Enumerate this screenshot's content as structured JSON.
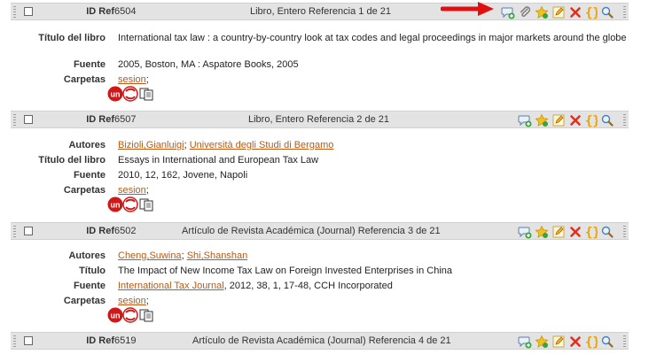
{
  "references": [
    {
      "id_label": "ID Ref",
      "id": "6504",
      "title": "Libro, Entero Referencia 1 de 21",
      "fields": [
        {
          "label": "Título del libro",
          "value": "International tax law : a country-by-country look at tax codes and legal proceedings in major markets around the globe"
        },
        {
          "label": "Fuente",
          "value": "2005, Boston, MA : Aspatore Books, 2005"
        },
        {
          "label": "Carpetas",
          "link": "sesion",
          "suffix": ";"
        }
      ]
    },
    {
      "id_label": "ID Ref",
      "id": "6507",
      "title": "Libro, Entero Referencia 2 de 21",
      "fields": [
        {
          "label": "Autores",
          "link": "Bizioli,Gianluigi",
          "sep": "; ",
          "link2": "Università degli Studi di Bergamo"
        },
        {
          "label": "Título del libro",
          "value": "Essays in International and European Tax Law"
        },
        {
          "label": "Fuente",
          "value": "2010, 12, 162, Jovene, Napoli"
        },
        {
          "label": "Carpetas",
          "link": "sesion",
          "suffix": ";"
        }
      ]
    },
    {
      "id_label": "ID Ref",
      "id": "6502",
      "title": "Artículo de Revista Académica (Journal) Referencia 3 de 21",
      "fields": [
        {
          "label": "Autores",
          "link": "Cheng,Suwina",
          "sep": "; ",
          "link2": "Shi,Shanshan"
        },
        {
          "label": "Título",
          "value": "The Impact of New Income Tax Law on Foreign Invested Enterprises in China"
        },
        {
          "label": "Fuente",
          "link": "International Tax Journal",
          "suffix": ", 2012, 38, 1, 17-48, CCH Incorporated"
        },
        {
          "label": "Carpetas",
          "link": "sesion",
          "suffix": ";"
        }
      ]
    },
    {
      "id_label": "ID Ref",
      "id": "6519",
      "title": "Artículo de Revista Académica (Journal) Referencia 4 de 21",
      "fields": []
    }
  ],
  "badge_text": "un",
  "colors": {
    "header_bg": "#e3e3e3",
    "link": "#b85a14",
    "arrow": "#e01010"
  }
}
